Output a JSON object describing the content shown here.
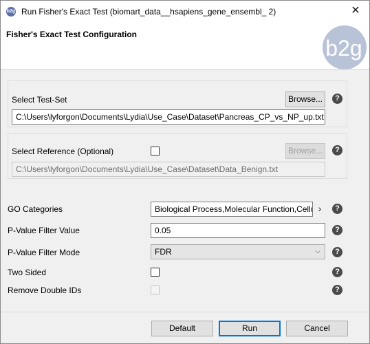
{
  "window": {
    "title": "Run Fisher's Exact Test (biomart_data__hsapiens_gene_ensembl_ 2)",
    "app_icon_text": "b2g"
  },
  "header": {
    "title": "Fisher's Exact Test Configuration",
    "logo_text": "b2g"
  },
  "test_set": {
    "label": "Select Test-Set",
    "browse_label": "Browse...",
    "path": "C:\\Users\\lyforgon\\Documents\\Lydia\\Use_Case\\Dataset\\Pancreas_CP_vs_NP_up.txt"
  },
  "reference": {
    "label": "Select Reference (Optional)",
    "browse_label": "Browse...",
    "path": "C:\\Users\\lyforgon\\Documents\\Lydia\\Use_Case\\Dataset\\Data_Benign.txt",
    "checked": false
  },
  "options": {
    "go_categories_label": "GO Categories",
    "go_categories_value": "Biological Process,Molecular Function,Cellu",
    "pvalue_filter_label": "P-Value Filter Value",
    "pvalue_filter_value": "0.05",
    "pvalue_mode_label": "P-Value Filter Mode",
    "pvalue_mode_value": "FDR",
    "two_sided_label": "Two Sided",
    "remove_double_ids_label": "Remove Double IDs"
  },
  "footer": {
    "default_label": "Default",
    "run_label": "Run",
    "cancel_label": "Cancel"
  },
  "icons": {
    "help": "?",
    "close": "✕",
    "chevron_right": "›",
    "dropdown": "⌵"
  }
}
